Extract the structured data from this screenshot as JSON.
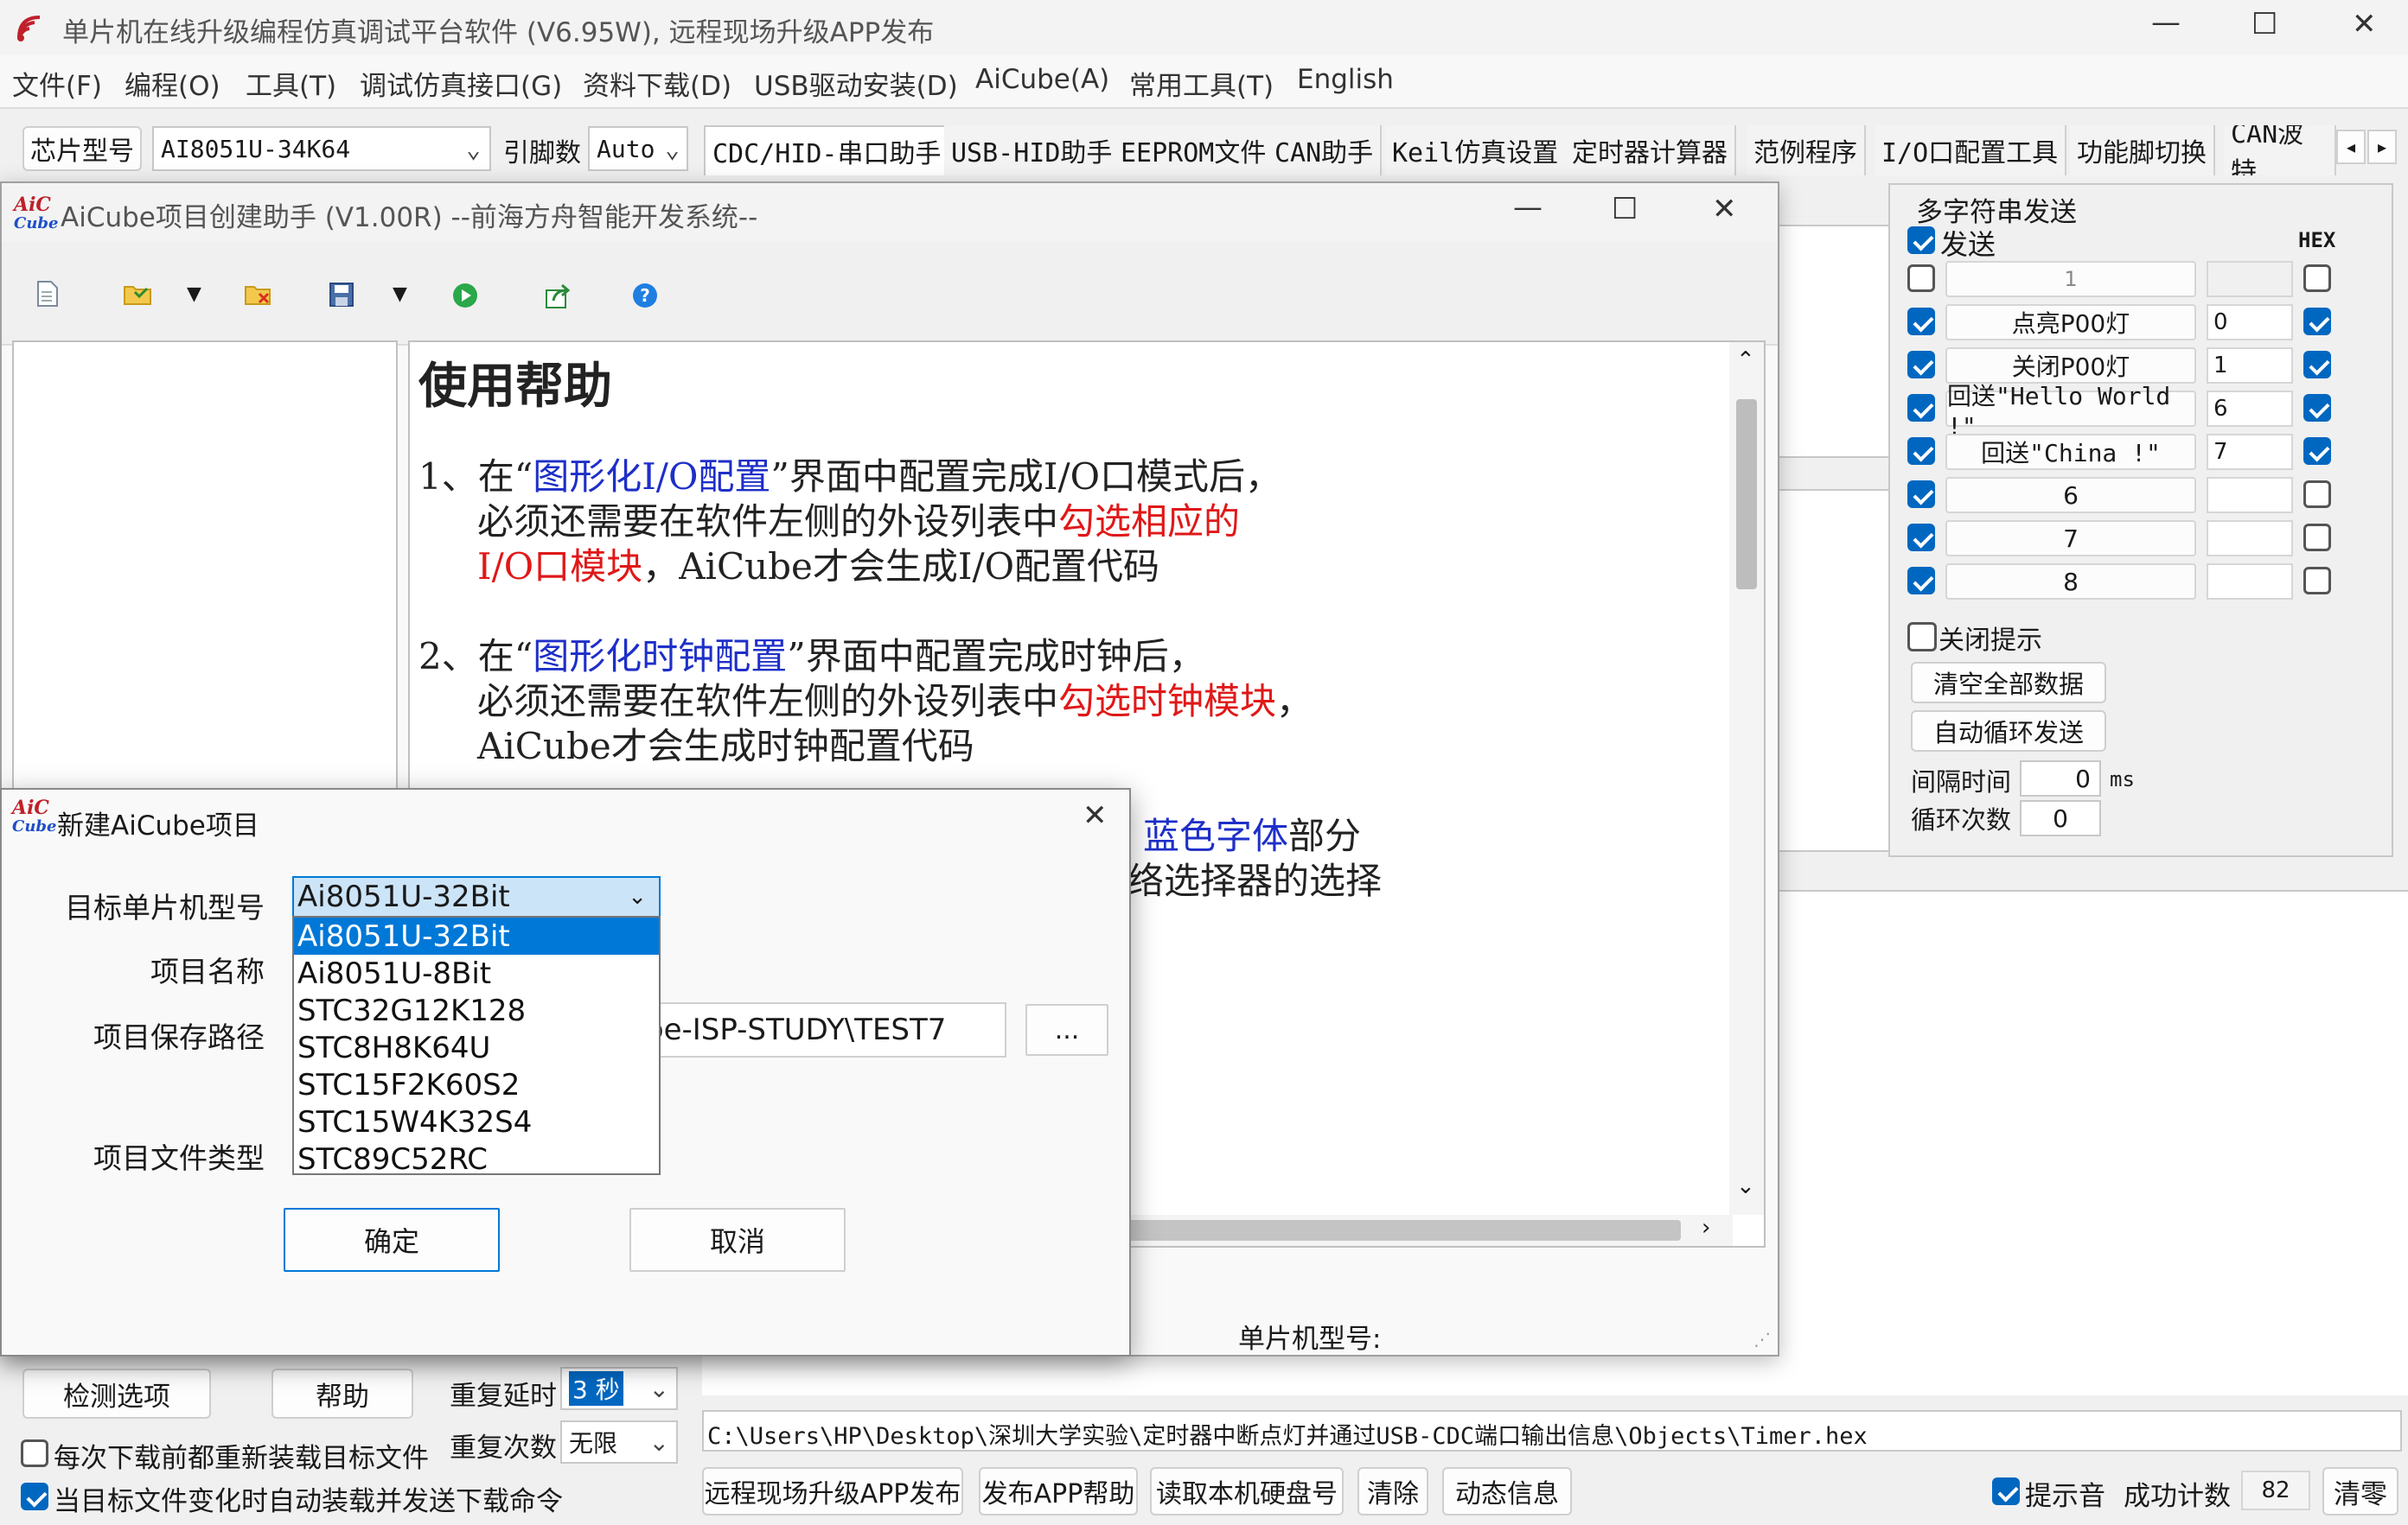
{
  "main_window": {
    "title": "单片机在线升级编程仿真调试平台软件 (V6.95W), 远程现场升级APP发布",
    "menu": [
      "文件(F)",
      "编程(O)",
      "工具(T)",
      "调试仿真接口(G)",
      "资料下载(D)",
      "USB驱动安装(D)",
      "AiCube(A)",
      "常用工具(T)",
      "English"
    ],
    "chip_label": "芯片型号",
    "chip_value": "AI8051U-34K64",
    "pin_label": "引脚数",
    "pin_value": "Auto",
    "tabs": [
      "CDC/HID-串口助手",
      "USB-HID助手",
      "EEPROM文件",
      "CAN助手",
      "Keil仿真设置",
      "定时器计算器",
      "范例程序",
      "I/O口配置工具",
      "功能脚切换",
      "CAN波特"
    ]
  },
  "right_panel": {
    "group_title": "多字符串发送",
    "send_label": "发送",
    "hex_label": "HEX",
    "rows": [
      {
        "checked": false,
        "text": "1",
        "hex": "",
        "hex_checked": false
      },
      {
        "checked": true,
        "text": "点亮P00灯",
        "hex": "0",
        "hex_checked": true
      },
      {
        "checked": true,
        "text": "关闭P00灯",
        "hex": "1",
        "hex_checked": true
      },
      {
        "checked": true,
        "text": "回送\"Hello World !\"",
        "hex": "6",
        "hex_checked": true
      },
      {
        "checked": true,
        "text": "回送\"China !\"",
        "hex": "7",
        "hex_checked": true
      },
      {
        "checked": true,
        "text": "6",
        "hex": "",
        "hex_checked": false
      },
      {
        "checked": true,
        "text": "7",
        "hex": "",
        "hex_checked": false
      },
      {
        "checked": true,
        "text": "8",
        "hex": "",
        "hex_checked": false
      }
    ],
    "close_tip": "关闭提示",
    "clear_all": "清空全部数据",
    "auto_loop": "自动循环发送",
    "interval_label": "间隔时间",
    "interval_value": "0",
    "interval_unit": "ms",
    "loop_label": "循环次数",
    "loop_value": "0"
  },
  "bottom": {
    "detect_options": "检测选项",
    "help": "帮助",
    "repeat_delay_label": "重复延时",
    "repeat_delay_value": "3 秒",
    "repeat_count_label": "重复次数",
    "repeat_count_value": "无限",
    "reload_each": "每次下载前都重新装载目标文件",
    "auto_reload": "当目标文件变化时自动装载并发送下载命令",
    "file_path": "C:\\Users\\HP\\Desktop\\深圳大学实验\\定时器中断点灯并通过USB-CDC端口输出信息\\Objects\\Timer.hex",
    "btn_remote": "远程现场升级APP发布",
    "btn_publish_help": "发布APP帮助",
    "btn_read_disk": "读取本机硬盘号",
    "btn_clear": "清除",
    "btn_dynamic": "动态信息",
    "tone_label": "提示音",
    "success_label": "成功计数",
    "success_value": "82",
    "btn_clear_count": "清零"
  },
  "helper_window": {
    "title": "AiCube项目创建助手 (V1.00R) --前海方舟智能开发系统--",
    "doc_title": "使用帮助",
    "item1": {
      "num": "1、",
      "p1": "在“",
      "link": "图形化I/O配置",
      "p2": "”界面中配置完成I/O口模式后，",
      "l2a": "必须还需要在软件左侧的外设列表中",
      "l2b": "勾选相应的",
      "l3a": "I/O口模块",
      "l3b": "，AiCube才会生成I/O配置代码"
    },
    "item2": {
      "num": "2、",
      "p1": "在“",
      "link": "图形化时钟配置",
      "p2": "”界面中配置完成时钟后，",
      "l2a": "必须还需要在软件左侧的外设列表中",
      "l2b": "勾选时钟模块",
      "l2c": "，",
      "l3": "AiCube才会生成时钟配置代码"
    },
    "item3_blue": "蓝色字体",
    "item3_tail": "部分",
    "item3_line2": "络选择器的选择",
    "status": "单片机型号:"
  },
  "dialog": {
    "title": "新建AiCube项目",
    "target_label": "目标单片机型号",
    "name_label": "项目名称",
    "path_label": "项目保存路径",
    "type_label": "项目文件类型",
    "selected": "Ai8051U-32Bit",
    "options": [
      "Ai8051U-32Bit",
      "Ai8051U-8Bit",
      "STC32G12K128",
      "STC8H8K64U",
      "STC15F2K60S2",
      "STC15W4K32S4",
      "STC89C52RC"
    ],
    "path_value": "be-ISP-STUDY\\TEST7",
    "browse": "...",
    "ok": "确定",
    "cancel": "取消"
  }
}
